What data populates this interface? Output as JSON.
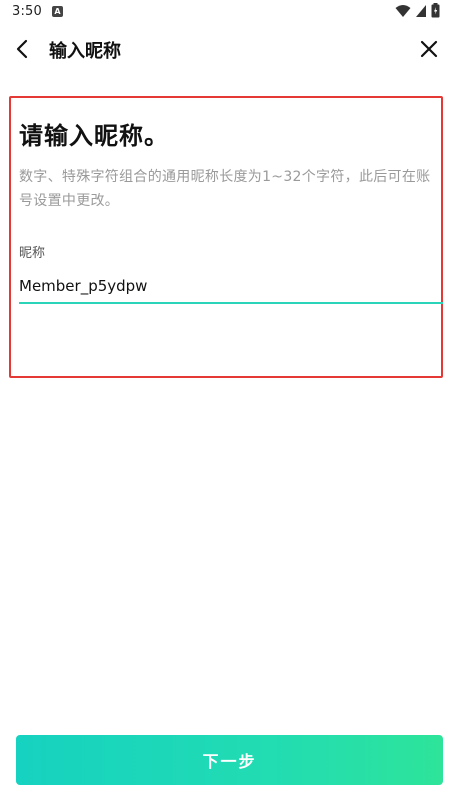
{
  "status_bar": {
    "time": "3:50",
    "notification_glyph": "A",
    "icons": [
      "wifi-icon",
      "signal-icon",
      "battery-icon"
    ]
  },
  "app_bar": {
    "title": "输入昵称",
    "back_icon": "chevron-left-icon",
    "close_icon": "close-icon"
  },
  "form": {
    "heading": "请输入昵称。",
    "description": "数字、特殊字符组合的通用昵称长度为1~32个字符，此后可在账号设置中更改。",
    "field_label": "昵称",
    "field_value": "Member_p5ydpw",
    "field_placeholder": ""
  },
  "footer": {
    "next_label": "下一步"
  },
  "colors": {
    "accent": "#2ad4b8",
    "highlight_border": "#e53935",
    "button_gradient_start": "#16d2c0",
    "button_gradient_end": "#2ee49a",
    "description_text": "#9a9a9a"
  }
}
